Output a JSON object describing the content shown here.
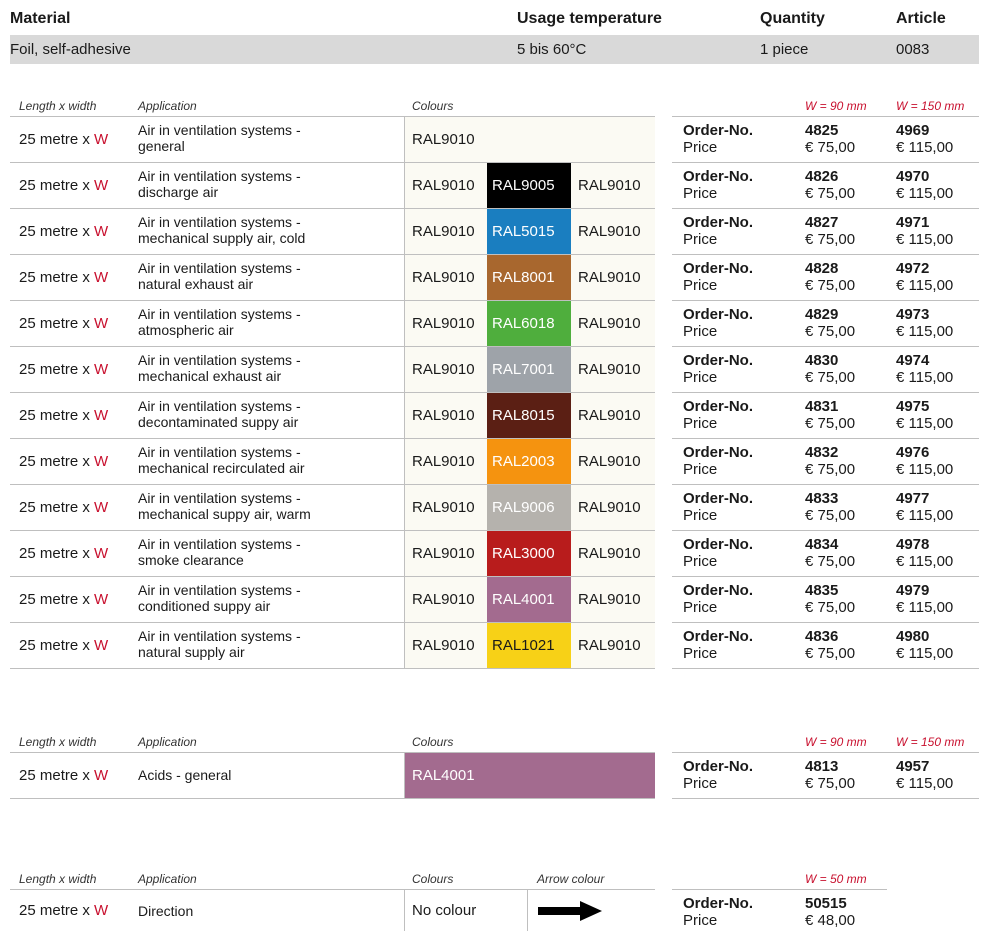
{
  "header": {
    "labels": {
      "material": "Material",
      "temp": "Usage temperature",
      "qty": "Quantity",
      "article": "Article"
    },
    "values": {
      "material": "Foil, self-adhesive",
      "temp": "5 bis 60°C",
      "qty": "1 piece",
      "article": "0083"
    }
  },
  "cols": {
    "size": "Length x width",
    "application": "Application",
    "colours": "Colours",
    "arrow_colour": "Arrow colour",
    "w90": "W = 90 mm",
    "w150": "W = 150 mm",
    "w50": "W = 50 mm"
  },
  "labels": {
    "order": "Order-No.",
    "price": "Price",
    "size_prefix": "25 metre x ",
    "w": "W"
  },
  "prices": {
    "p90": "€ 75,00",
    "p150": "€ 115,00",
    "p50": "€ 48,00"
  },
  "section1": [
    {
      "app1": "Air in ventilation systems -",
      "app2": "general",
      "c1": "RAL9010",
      "c2": "",
      "c3": "",
      "swatch": "",
      "text": "",
      "o90": "4825",
      "o150": "4969"
    },
    {
      "app1": "Air in ventilation systems -",
      "app2": "discharge air",
      "c1": "RAL9010",
      "c2": "RAL9005",
      "c3": "RAL9010",
      "swatch": "#000000",
      "text": "#ffffff",
      "o90": "4826",
      "o150": "4970"
    },
    {
      "app1": "Air in ventilation systems -",
      "app2": "mechanical supply air, cold",
      "c1": "RAL9010",
      "c2": "RAL5015",
      "c3": "RAL9010",
      "swatch": "#1a7ec0",
      "text": "#ffffff",
      "o90": "4827",
      "o150": "4971"
    },
    {
      "app1": "Air in ventilation systems -",
      "app2": "natural exhaust air",
      "c1": "RAL9010",
      "c2": "RAL8001",
      "c3": "RAL9010",
      "swatch": "#a8672e",
      "text": "#ffffff",
      "o90": "4828",
      "o150": "4972"
    },
    {
      "app1": "Air in ventilation systems -",
      "app2": "atmospheric air",
      "c1": "RAL9010",
      "c2": "RAL6018",
      "c3": "RAL9010",
      "swatch": "#4fae3d",
      "text": "#ffffff",
      "o90": "4829",
      "o150": "4973"
    },
    {
      "app1": "Air in ventilation systems -",
      "app2": "mechanical exhaust air",
      "c1": "RAL9010",
      "c2": "RAL7001",
      "c3": "RAL9010",
      "swatch": "#9ea3a9",
      "text": "#ffffff",
      "o90": "4830",
      "o150": "4974"
    },
    {
      "app1": "Air in ventilation systems -",
      "app2": "decontaminated suppy air",
      "c1": "RAL9010",
      "c2": "RAL8015",
      "c3": "RAL9010",
      "swatch": "#5b1f14",
      "text": "#ffffff",
      "o90": "4831",
      "o150": "4975"
    },
    {
      "app1": "Air in ventilation systems -",
      "app2": "mechanical recirculated air",
      "c1": "RAL9010",
      "c2": "RAL2003",
      "c3": "RAL9010",
      "swatch": "#f5930f",
      "text": "#ffffff",
      "o90": "4832",
      "o150": "4976"
    },
    {
      "app1": "Air in ventilation systems -",
      "app2": "mechanical suppy air, warm",
      "c1": "RAL9010",
      "c2": "RAL9006",
      "c3": "RAL9010",
      "swatch": "#b5b2ad",
      "text": "#ffffff",
      "o90": "4833",
      "o150": "4977"
    },
    {
      "app1": "Air in ventilation systems -",
      "app2": "smoke clearance",
      "c1": "RAL9010",
      "c2": "RAL3000",
      "c3": "RAL9010",
      "swatch": "#b81c1c",
      "text": "#ffffff",
      "o90": "4834",
      "o150": "4978"
    },
    {
      "app1": "Air in ventilation systems -",
      "app2": "conditioned suppy air",
      "c1": "RAL9010",
      "c2": "RAL4001",
      "c3": "RAL9010",
      "swatch": "#a36b8f",
      "text": "#ffffff",
      "o90": "4835",
      "o150": "4979"
    },
    {
      "app1": "Air in ventilation systems -",
      "app2": "natural supply air",
      "c1": "RAL9010",
      "c2": "RAL1021",
      "c3": "RAL9010",
      "swatch": "#f7d117",
      "text": "#1a1a1a",
      "o90": "4836",
      "o150": "4980"
    }
  ],
  "section2": {
    "app": "Acids - general",
    "colour": "RAL4001",
    "swatch": "#a36b8f",
    "o90": "4813",
    "o150": "4957"
  },
  "section3": {
    "app": "Direction",
    "colour": "No colour",
    "o50": "50515"
  }
}
